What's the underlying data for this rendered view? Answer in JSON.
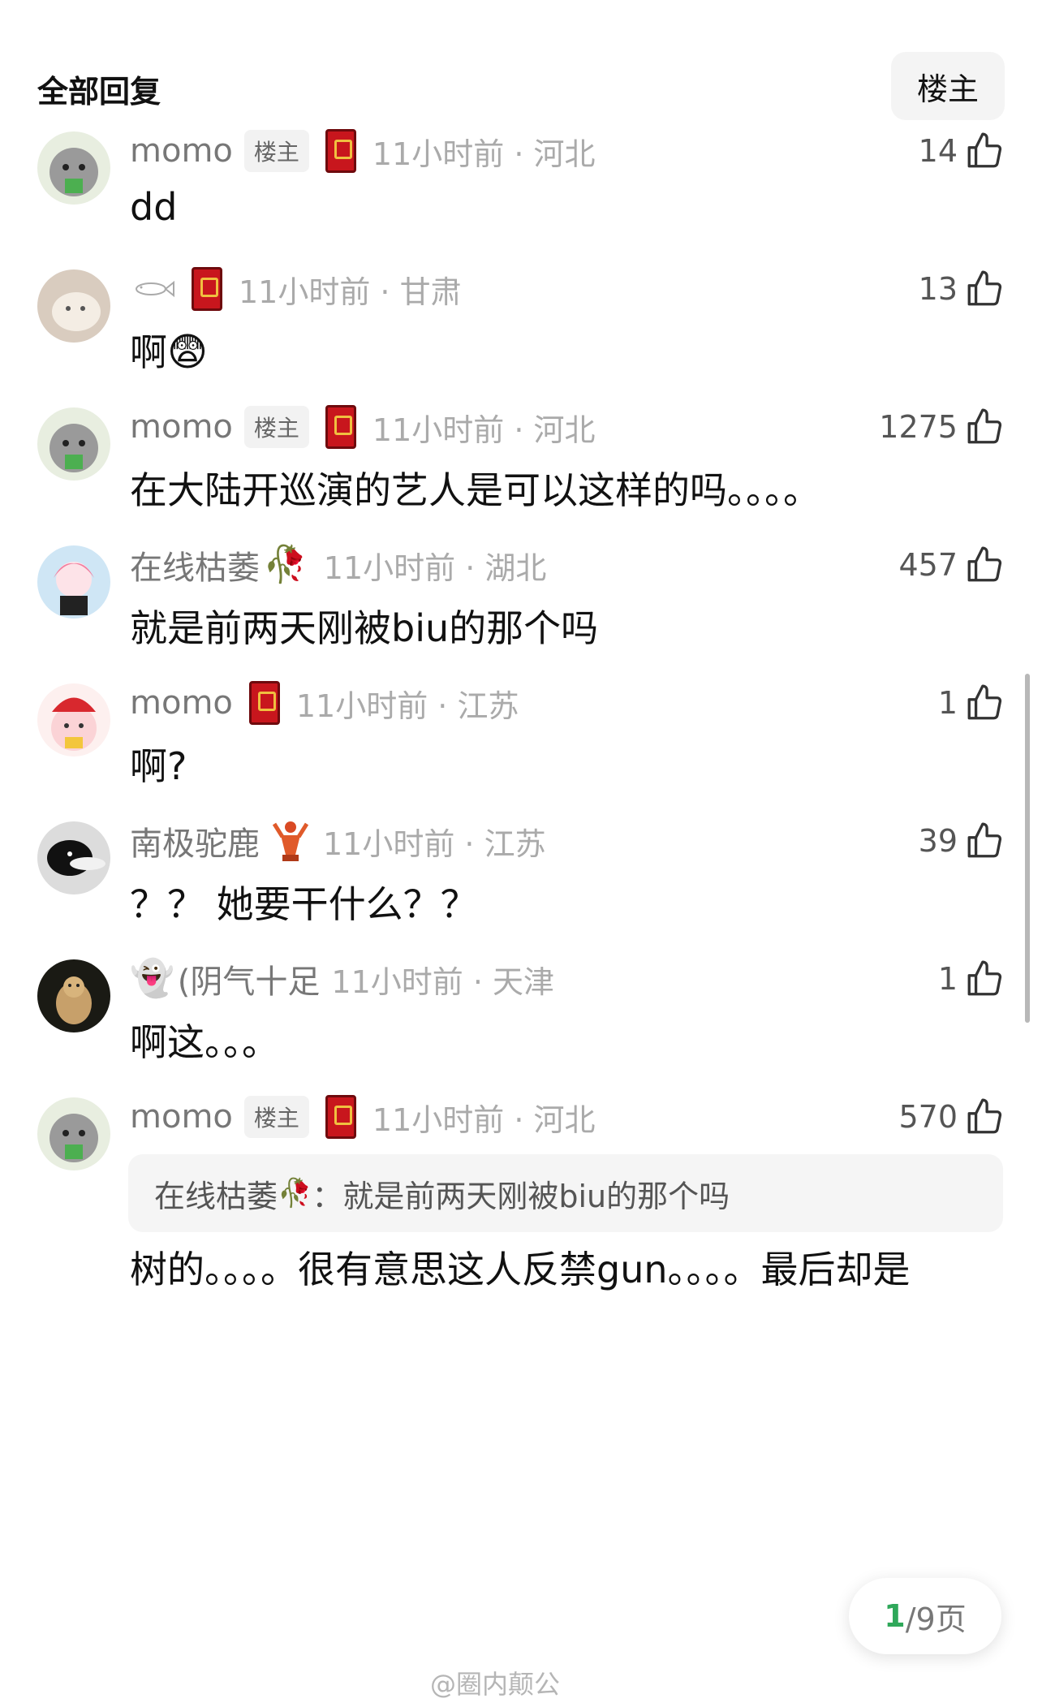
{
  "header": {
    "title": "全部回复",
    "filter_button": "楼主"
  },
  "comments": [
    {
      "user": "momo",
      "op_badge": "楼主",
      "time_loc": "11小时前 · 河北",
      "likes": "14",
      "text": "dd"
    },
    {
      "user": "",
      "time_loc": "11小时前 · 甘肃",
      "likes": "13",
      "text": "啊",
      "emoji": "😨"
    },
    {
      "user": "momo",
      "op_badge": "楼主",
      "time_loc": "11小时前 · 河北",
      "likes": "1275",
      "text": "在大陆开巡演的艺人是可以这样的吗。。。。"
    },
    {
      "user": "在线枯萎",
      "user_deco": "🥀",
      "time_loc": "11小时前 · 湖北",
      "likes": "457",
      "text": "就是前两天刚被biu的那个吗"
    },
    {
      "user": "momo",
      "time_loc": "11小时前 · 江苏",
      "likes": "1",
      "text": "啊?"
    },
    {
      "user": "南极驼鹿",
      "time_loc": "11小时前 · 江苏",
      "likes": "39",
      "text": "？？ 她要干什么？？"
    },
    {
      "user": "(阴气十足",
      "user_prefix": "👻",
      "time_loc": "11小时前 · 天津",
      "likes": "1",
      "text": "啊这。。。"
    },
    {
      "user": "momo",
      "op_badge": "楼主",
      "time_loc": "11小时前 · 河北",
      "likes": "570",
      "quote_user": "在线枯萎",
      "quote_deco": "🥀",
      "quote_sep": "：",
      "quote_text": "就是前两天刚被biu的那个吗",
      "text": "树的。。。。很有意思这人反禁gun。。。。最后却是"
    }
  ],
  "pagination": {
    "current": "1",
    "total_label": "/9页"
  },
  "watermark": "@圈内颠公"
}
